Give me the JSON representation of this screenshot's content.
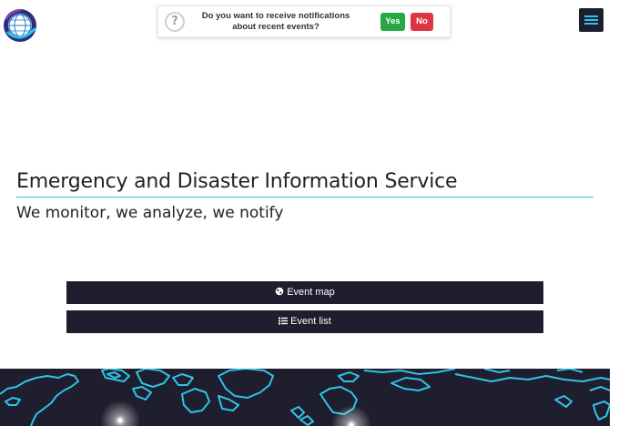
{
  "notification": {
    "message": "Do you want to receive notifications about recent events?",
    "yes_label": "Yes",
    "no_label": "No"
  },
  "hero": {
    "title": "Emergency and Disaster Information Service",
    "subtitle": "We monitor, we analyze, we notify"
  },
  "actions": {
    "event_map_label": "Event map",
    "event_list_label": "Event list"
  },
  "icons": {
    "logo": "globe-logo-icon",
    "question": "question-circle-icon",
    "menu": "hamburger-menu-icon",
    "map": "globe-icon",
    "list": "list-icon"
  },
  "colors": {
    "dark": "#1e1e2e",
    "accent": "#2fc4e6",
    "yes": "#28a745",
    "no": "#dc3545"
  }
}
